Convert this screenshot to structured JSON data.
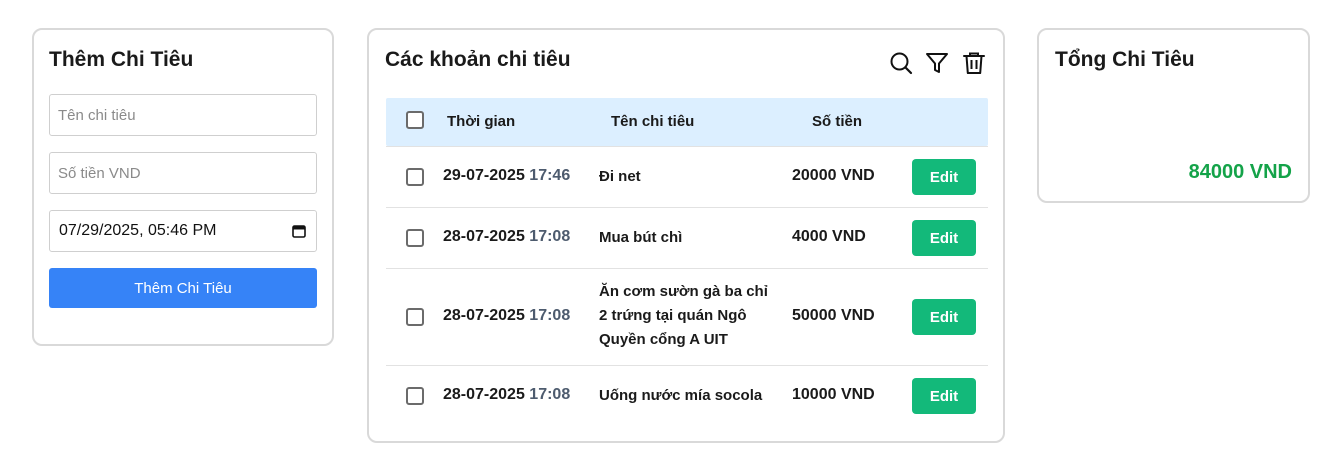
{
  "add_form": {
    "title": "Thêm Chi Tiêu",
    "name_placeholder": "Tên chi tiêu",
    "amount_placeholder": "Số tiền VND",
    "date_value": "07/29/2025, 05:46 PM",
    "submit_label": "Thêm Chi Tiêu"
  },
  "list": {
    "title": "Các khoản chi tiêu",
    "toolbar": {
      "icons": [
        "search-icon",
        "filter-icon",
        "trash-icon"
      ]
    },
    "headers": {
      "time": "Thời gian",
      "name": "Tên chi tiêu",
      "amount": "Số tiền"
    },
    "rows": [
      {
        "date": "29-07-2025",
        "time": "17:46",
        "name": "Đi net",
        "amount": "20000 VND",
        "action": "Edit"
      },
      {
        "date": "28-07-2025",
        "time": "17:08",
        "name": "Mua bút chì",
        "amount": "4000 VND",
        "action": "Edit"
      },
      {
        "date": "28-07-2025",
        "time": "17:08",
        "name": "Ăn cơm sườn gà ba chỉ 2 trứng tại quán Ngô Quyền cổng A UIT",
        "amount": "50000 VND",
        "action": "Edit"
      },
      {
        "date": "28-07-2025",
        "time": "17:08",
        "name": "Uống nước mía socola",
        "amount": "10000 VND",
        "action": "Edit"
      }
    ]
  },
  "total": {
    "title": "Tổng Chi Tiêu",
    "value": "84000 VND"
  },
  "colors": {
    "primary_button": "#3683f7",
    "edit_button": "#13b97a",
    "total_value": "#14a349",
    "table_header_bg": "#dcefff"
  }
}
